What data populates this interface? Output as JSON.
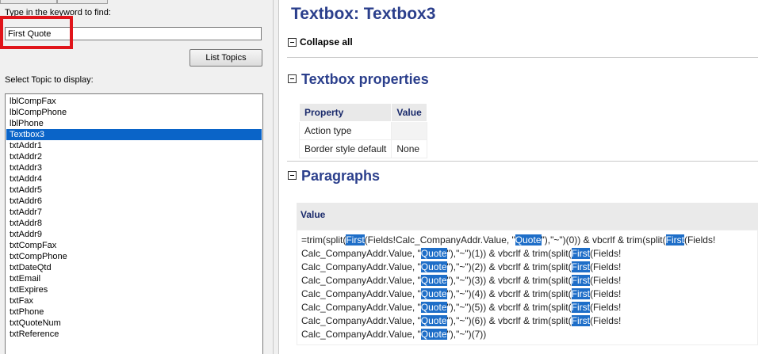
{
  "left_pane": {
    "keyword_label": "Type in the keyword to find:",
    "keyword_value": "First Quote",
    "list_topics_button": "List Topics",
    "topic_label": "Select Topic to display:",
    "topics": [
      {
        "label": "lblCompFax",
        "selected": false
      },
      {
        "label": "lblCompPhone",
        "selected": false
      },
      {
        "label": "lblPhone",
        "selected": false
      },
      {
        "label": "Textbox3",
        "selected": true
      },
      {
        "label": "txtAddr1",
        "selected": false
      },
      {
        "label": "txtAddr2",
        "selected": false
      },
      {
        "label": "txtAddr3",
        "selected": false
      },
      {
        "label": "txtAddr4",
        "selected": false
      },
      {
        "label": "txtAddr5",
        "selected": false
      },
      {
        "label": "txtAddr6",
        "selected": false
      },
      {
        "label": "txtAddr7",
        "selected": false
      },
      {
        "label": "txtAddr8",
        "selected": false
      },
      {
        "label": "txtAddr9",
        "selected": false
      },
      {
        "label": "txtCompFax",
        "selected": false
      },
      {
        "label": "txtCompPhone",
        "selected": false
      },
      {
        "label": "txtDateQtd",
        "selected": false
      },
      {
        "label": "txtEmail",
        "selected": false
      },
      {
        "label": "txtExpires",
        "selected": false
      },
      {
        "label": "txtFax",
        "selected": false
      },
      {
        "label": "txtPhone",
        "selected": false
      },
      {
        "label": "txtQuoteNum",
        "selected": false
      },
      {
        "label": "txtReference",
        "selected": false
      }
    ]
  },
  "right_pane": {
    "title": "Textbox: Textbox3",
    "collapse_all": "Collapse all",
    "textbox_properties": {
      "heading": "Textbox properties",
      "columns": [
        "Property",
        "Value"
      ],
      "rows": [
        [
          "Action type",
          ""
        ],
        [
          "Border style default",
          "None"
        ]
      ]
    },
    "paragraphs": {
      "heading": "Paragraphs",
      "value_header": "Value",
      "lines": [
        [
          {
            "t": "=trim(split("
          },
          {
            "t": "First",
            "hl": true
          },
          {
            "t": "(Fields!Calc_CompanyAddr.Value, \""
          },
          {
            "t": "Quote",
            "hl": true
          },
          {
            "t": "\"),\"~\")(0)) & vbcrlf & trim(split("
          },
          {
            "t": "First",
            "hl": true
          },
          {
            "t": "(Fields!"
          }
        ],
        [
          {
            "t": "Calc_CompanyAddr.Value, \""
          },
          {
            "t": "Quote",
            "hl": true
          },
          {
            "t": "\"),\"~\")(1)) & vbcrlf & trim(split("
          },
          {
            "t": "First",
            "hl": true
          },
          {
            "t": "(Fields!"
          }
        ],
        [
          {
            "t": "Calc_CompanyAddr.Value, \""
          },
          {
            "t": "Quote",
            "hl": true
          },
          {
            "t": "\"),\"~\")(2)) & vbcrlf & trim(split("
          },
          {
            "t": "First",
            "hl": true
          },
          {
            "t": "(Fields!"
          }
        ],
        [
          {
            "t": "Calc_CompanyAddr.Value, \""
          },
          {
            "t": "Quote",
            "hl": true
          },
          {
            "t": "\"),\"~\")(3)) & vbcrlf & trim(split("
          },
          {
            "t": "First",
            "hl": true
          },
          {
            "t": "(Fields!"
          }
        ],
        [
          {
            "t": "Calc_CompanyAddr.Value, \""
          },
          {
            "t": "Quote",
            "hl": true
          },
          {
            "t": "\"),\"~\")(4)) & vbcrlf & trim(split("
          },
          {
            "t": "First",
            "hl": true
          },
          {
            "t": "(Fields!"
          }
        ],
        [
          {
            "t": "Calc_CompanyAddr.Value, \""
          },
          {
            "t": "Quote",
            "hl": true
          },
          {
            "t": "\"),\"~\")(5)) & vbcrlf & trim(split("
          },
          {
            "t": "First",
            "hl": true
          },
          {
            "t": "(Fields!"
          }
        ],
        [
          {
            "t": "Calc_CompanyAddr.Value, \""
          },
          {
            "t": "Quote",
            "hl": true
          },
          {
            "t": "\"),\"~\")(6)) & vbcrlf & trim(split("
          },
          {
            "t": "First",
            "hl": true
          },
          {
            "t": "(Fields!"
          }
        ],
        [
          {
            "t": "Calc_CompanyAddr.Value, \""
          },
          {
            "t": "Quote",
            "hl": true
          },
          {
            "t": "\"),\"~\")(7))"
          }
        ]
      ]
    }
  }
}
